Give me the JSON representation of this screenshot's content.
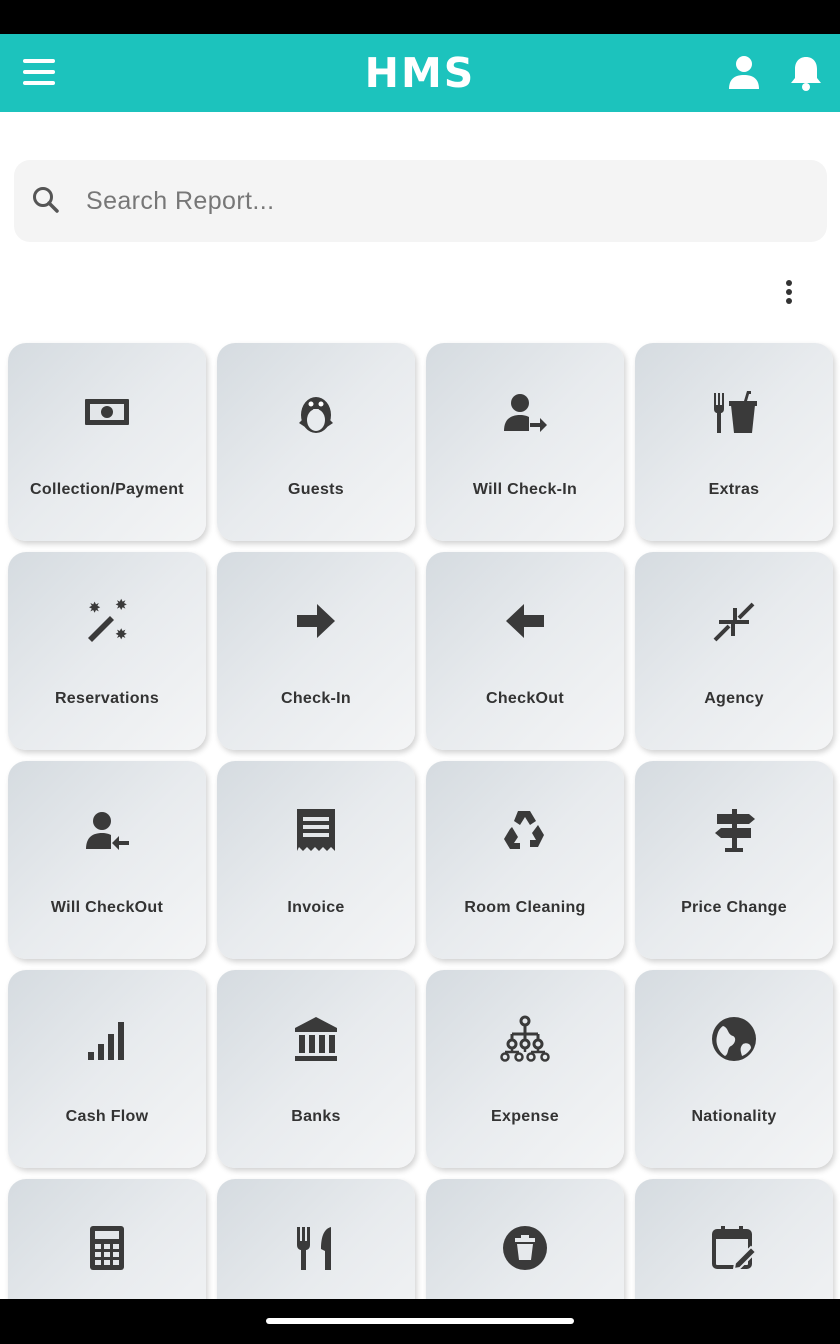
{
  "app_bar": {
    "title": "HMS",
    "menu_icon": "hamburger-menu-icon",
    "profile_icon": "person-icon",
    "notification_icon": "bell-icon",
    "color": "#1cc3bd"
  },
  "search": {
    "placeholder": "Search Report...",
    "value": "",
    "icon": "search-icon"
  },
  "overflow_menu_icon": "more-vert-icon",
  "reports": [
    {
      "label": "Collection/Payment",
      "icon": "money-icon"
    },
    {
      "label": "Guests",
      "icon": "penguin-icon"
    },
    {
      "label": "Will Check-In",
      "icon": "person-arrow-right-icon"
    },
    {
      "label": "Extras",
      "icon": "fork-cup-icon"
    },
    {
      "label": "Reservations",
      "icon": "magic-wand-icon"
    },
    {
      "label": "Check-In",
      "icon": "arrow-right-icon"
    },
    {
      "label": "CheckOut",
      "icon": "arrow-left-icon"
    },
    {
      "label": "Agency",
      "icon": "compress-arrows-icon"
    },
    {
      "label": "Will CheckOut",
      "icon": "person-arrow-left-icon"
    },
    {
      "label": "Invoice",
      "icon": "receipt-icon"
    },
    {
      "label": "Room Cleaning",
      "icon": "recycle-icon"
    },
    {
      "label": "Price Change",
      "icon": "signpost-icon"
    },
    {
      "label": "Cash Flow",
      "icon": "signal-bars-icon"
    },
    {
      "label": "Banks",
      "icon": "bank-icon"
    },
    {
      "label": "Expense",
      "icon": "sitemap-icon"
    },
    {
      "label": "Nationality",
      "icon": "globe-icon"
    },
    {
      "label": "",
      "icon": "calculator-icon"
    },
    {
      "label": "",
      "icon": "utensils-icon"
    },
    {
      "label": "",
      "icon": "trash-circle-icon"
    },
    {
      "label": "",
      "icon": "calendar-edit-icon"
    }
  ]
}
